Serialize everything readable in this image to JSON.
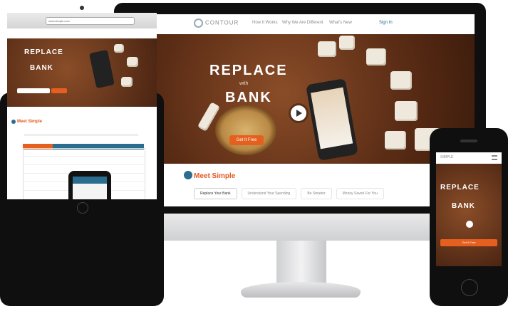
{
  "desktop": {
    "logo": "CONTOUR",
    "nav": [
      "How It Works",
      "Why We Are Different",
      "What's New",
      "Sign In"
    ],
    "hero": {
      "title_line1": "REPLACE",
      "connector": "with",
      "title_line2": "BANK",
      "cta": "Get It Free"
    },
    "section_title": "Meet Simple",
    "tabs": [
      "Replace Your Bank",
      "Understand Your Spending",
      "Be Smarter",
      "Money Saved For You"
    ]
  },
  "tablet": {
    "url": "www.simple.com",
    "hero": {
      "title_line1": "REPLACE",
      "title_line2": "BANK"
    },
    "section_title": "Meet Simple"
  },
  "phone": {
    "logo": "SIMPLE",
    "hero": {
      "title_line1": "REPLACE",
      "title_line2": "BANK",
      "cta": "Get It Free"
    }
  },
  "colors": {
    "accent": "#e5601e",
    "brand_blue": "#2b6d8e",
    "device": "#0f0f10"
  }
}
